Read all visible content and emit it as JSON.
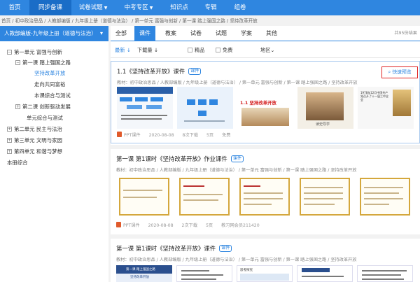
{
  "nav": {
    "items": [
      {
        "label": "首页",
        "dropdown": false,
        "active": false
      },
      {
        "label": "同步备课",
        "dropdown": false,
        "active": true
      },
      {
        "label": "试卷试题",
        "dropdown": true,
        "active": false
      },
      {
        "label": "中考专区",
        "dropdown": true,
        "active": false
      },
      {
        "label": "知识点",
        "dropdown": false,
        "active": false
      },
      {
        "label": "专辑",
        "dropdown": false,
        "active": false
      },
      {
        "label": "组卷",
        "dropdown": false,
        "active": false
      }
    ]
  },
  "breadcrumb": "首页 / 初中政治思品 / 人教部编版 / 九年级上册（道德与法治） / 第一单元 富强与创新 / 第一课 踏上强国之路 / 坚持改革开放",
  "sidebar": {
    "header": "人教部编版-九年级上册（道德与法治）",
    "tree": [
      {
        "label": "第一单元 富强与创新",
        "toggle": "⊟"
      },
      {
        "label": "第一课 踏上强国之路",
        "toggle": "⊟"
      },
      {
        "label": "坚持改革开放",
        "toggle": ""
      },
      {
        "label": "走向共同富裕",
        "toggle": ""
      },
      {
        "label": "本课综合与测试",
        "toggle": ""
      },
      {
        "label": "第二课 创新驱动发展",
        "toggle": "⊞"
      },
      {
        "label": "单元综合与测试",
        "toggle": ""
      },
      {
        "label": "第二单元 民主与法治",
        "toggle": "⊞"
      },
      {
        "label": "第三单元 文明与家园",
        "toggle": "⊞"
      },
      {
        "label": "第四单元 和谐与梦想",
        "toggle": "⊞"
      },
      {
        "label": "本册综合",
        "toggle": ""
      }
    ]
  },
  "tabs": [
    "全部",
    "课件",
    "教案",
    "试卷",
    "试题",
    "学案",
    "其他"
  ],
  "active_tab": "课件",
  "result_count": "共95份结果",
  "filters": {
    "sort_newest": "最新",
    "sort_newest_icon": "↓",
    "sort_downloads": "下载量",
    "sort_downloads_icon": "↓",
    "premium": "精品",
    "free": "免费",
    "region": "地区",
    "region_icon": "⌄"
  },
  "cards": [
    {
      "title": "1.1《坚持改革开放》课件",
      "badge": "课件",
      "path": "教材：初中政治思品 / 人教部编版 / 九年级上册（道德与法治） / 第一单元 富强与创新 / 第一课 踏上强国之路 / 坚持改革开放",
      "type": "PPT课件",
      "date": "2020-08-08",
      "downloads": "8次下载",
      "pages": "5页",
      "price": "免费",
      "quick_preview": "快速预览"
    },
    {
      "title": "第一课 第1课时《坚持改革开放》作业课件",
      "badge": "课件",
      "path": "教材：初中政治思品 / 人教部编版 / 九年级上册（道德与法治） / 第一单元 富强与创新 / 第一课 踏上强国之路 / 坚持改革开放",
      "type": "PPT课件",
      "date": "2020-08-08",
      "downloads": "2次下载",
      "pages": "5页",
      "price": "教习网会员211420"
    },
    {
      "title": "第一课 第1课时《坚持改革开放》课件",
      "badge": "课件",
      "path": "教材：初中政治思品 / 人教部编版 / 九年级上册（道德与法治） / 第一单元 富强与创新 / 第一课 踏上强国之路 / 坚持改革开放"
    }
  ],
  "thumb_text": {
    "slide_title": "1.1 坚持改革开放",
    "study_guide": "读史导学",
    "thumb_heading": "第一课 踏上强国之路",
    "thumb_subheading": "坚持改革开放",
    "thumb_task": "思考探究",
    "thumb_snippet": "1978年12月中国共产党召开了十一届三中全会"
  },
  "colors": {
    "primary": "#2f86e0",
    "highlight_border": "#e02424"
  }
}
